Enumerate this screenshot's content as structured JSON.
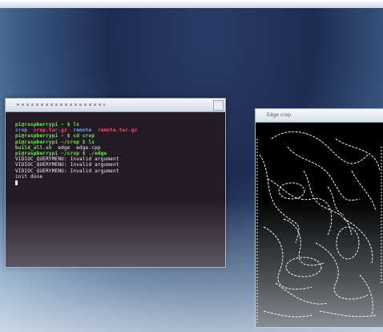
{
  "terminal": {
    "lines": [
      [
        {
          "t": "pi@raspberrypi ~ $ ls",
          "c": "g"
        }
      ],
      [
        {
          "t": "crop  ",
          "c": "b"
        },
        {
          "t": "crop.tar.gz  ",
          "c": "r"
        },
        {
          "t": "remote  ",
          "c": "b"
        },
        {
          "t": "remote.tar.gz",
          "c": "r"
        }
      ],
      [
        {
          "t": "pi@raspberrypi ~ $ cd crop",
          "c": "g"
        }
      ],
      [
        {
          "t": "pi@raspberrypi ~/crop $ ls",
          "c": "g"
        }
      ],
      [
        {
          "t": "build_all.sh  ",
          "c": "g"
        },
        {
          "t": "edge  edge.cpp",
          "c": "w"
        }
      ],
      [
        {
          "t": "pi@raspberrypi ~/crop $ ./edge",
          "c": "g"
        }
      ],
      [
        {
          "t": "VIDIOC_QUERYMENU: Invalid argument",
          "c": "w"
        }
      ],
      [
        {
          "t": "VIDIOC_QUERYMENU: Invalid argument",
          "c": "w"
        }
      ],
      [
        {
          "t": "VIDIOC_QUERYMENU: Invalid argument",
          "c": "w"
        }
      ],
      [
        {
          "t": "init done",
          "c": "w"
        }
      ]
    ]
  },
  "edge_window": {
    "title": "Edge crop"
  }
}
